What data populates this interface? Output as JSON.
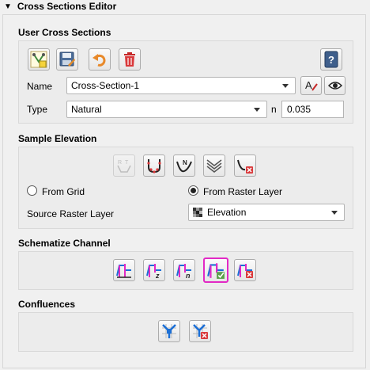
{
  "panel": {
    "title": "Cross Sections Editor"
  },
  "user_cross_sections": {
    "title": "User Cross Sections",
    "toolbar_icons": [
      "add-cross-section-icon",
      "save-icon",
      "undo-icon",
      "delete-icon",
      "help-icon"
    ],
    "name_label": "Name",
    "name_value": "Cross-Section-1",
    "type_label": "Type",
    "type_value": "Natural",
    "n_label": "n",
    "n_value": "0.035"
  },
  "sample_elevation": {
    "title": "Sample Elevation",
    "tool_icons": [
      "rt-profile-icon",
      "sample-points-icon",
      "n-profile-icon",
      "stacked-profile-icon",
      "delete-profile-icon"
    ],
    "from_grid_label": "From Grid",
    "from_grid_checked": false,
    "from_raster_label": "From Raster Layer",
    "from_raster_checked": true,
    "source_raster_label": "Source Raster Layer",
    "source_raster_value": "Elevation"
  },
  "schematize_channel": {
    "title": "Schematize Channel",
    "tool_icons": [
      "schematize-icon",
      "schematize-z-icon",
      "schematize-n-icon",
      "schematize-check-icon",
      "schematize-delete-icon"
    ]
  },
  "confluences": {
    "title": "Confluences",
    "tool_icons": [
      "confluence-icon",
      "confluence-delete-icon"
    ]
  },
  "colors": {
    "accent_magenta": "#e229c5",
    "accent_blue": "#1b6fd6",
    "delete_red": "#d9393b"
  }
}
